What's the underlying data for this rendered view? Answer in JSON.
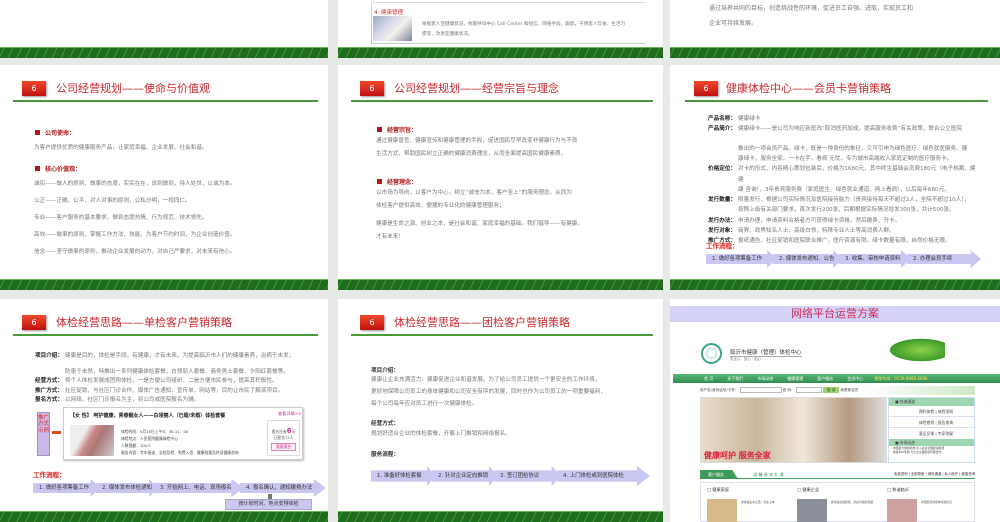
{
  "top_row": {
    "s2_heading": "4. 健康管理",
    "s2_text": [
      "根据客人亚健康状况，依靠呼叫中心 Call Center 和短信、网络手段，跟踪，干预客人饮食、生活习",
      "惯等，改善亚健康状况。"
    ],
    "s3_text": [
      "通过培养共同的目标，创造挑战性的环境，促进员工自强、进取，实现员工和",
      "企业可持续发展。"
    ]
  },
  "slide_number": "6",
  "mission": {
    "title": "公司经营规划——使命与价值观",
    "h1": "公司使命：",
    "p1": "为客户提供优质的健康服务产品，让家庭幸福、企业发展、社会和谐。",
    "h2": "核心价值观：",
    "values": [
      "诚实——做人的原则，做事的态度，实实在在，说到做到，待人处世，以诚为本。",
      "公正——正确、公平，对人对事的原则，公私分明，一视同仁。",
      "专业——客户服务的基本要求，做到态度热情、行为规范、技术领先。",
      "高效——做事的原则，掌握工作方法、技能，为客户节约时间，为企业创造价值。",
      "信念——坚守做事的原则，推动企业发展的动力，对自己严要求，对未来有信心。"
    ]
  },
  "purpose": {
    "title": "公司经营规划——经营宗旨与理念",
    "h1": "经营宗旨：",
    "p1": [
      "通过健康普查、健康宣传和健康管理的手段，促进国民尽早改变非健康行为与不良",
      "生活方式，帮助国民树立正确的健康消费理念，从而全面提高国民健康素质。"
    ],
    "h2": "经营理念：",
    "p2": [
      "以市场为导向，以客户为中心，树立“诚信为本，客户至上”的服务理念，从而为",
      "体检客户提供高效、便捷的专业化的健康管理服务；"
    ],
    "p3": [
      "健康是生命之源、创业之本，是社会和谐、家庭幸福的基础。我们倡导——有健康，",
      "才有未来！"
    ]
  },
  "card": {
    "title": "健康体检中心——会员卡营销策略",
    "lines": [
      {
        "k": "产品名称：",
        "v": "健康绿卡"
      },
      {
        "k": "产品简介：",
        "v": "健康绿卡——是公司为响应新医改“取消医药加成，提高服务收费”有关政策，联合公立医院"
      },
      {
        "k": "",
        "v": "推出的一项会员产品。绿卡，既是一种身份的象征，又可引申为绿色医疗、绿色就医服务、健"
      },
      {
        "k": "",
        "v": "康绿卡，服务全家。一卡在手，看病 无忧。专为城市高端收入家庭定制的医疗服务卡。"
      },
      {
        "k": "价格定位：",
        "v": "对卡的形式、内容精心策划包装后，价格为1680元，其中终生基础会员费180元（电子档案、健"
      },
      {
        "k": "",
        "v": "健"
      },
      {
        "k": "",
        "v": "康 咨询），3年贵宾服务费（家庭医生、绿色就业通道、网上看病），以后每年680元。"
      },
      {
        "k": "发行数量：",
        "v": "限量发行，根据公司实际情况及医院接待能力（贵宾接待每天不超过2人，全院不超过10人），"
      },
      {
        "k": "",
        "v": "按照上级有关部门要求，首次发行200张，后期根据实际情况增发300张，共计500张。"
      },
      {
        "k": "发行办法：",
        "v": "申请办理，申请资料合格者方可获得绿卡资格，然后缴费、开卡。"
      },
      {
        "k": "发行对象：",
        "v": "商界、政界知名人士，高级白领，特殊专业人士等高消费人群。"
      },
      {
        "k": "推广方式：",
        "v": "报纸通告、社区促销和医院联合推广，医疗资源有限，绿卡数量有限，自然价格无限。"
      }
    ],
    "flow_label": "工作流程：",
    "flow": [
      "1. 做好各项筹备工作",
      "2. 媒体发布通知、公告",
      "3. 收集、审核申请资料",
      "2. 办理会员手续"
    ]
  },
  "single": {
    "title": "体检经营思路——单检客户营销策略",
    "lines": [
      {
        "k": "项目介绍：",
        "v": "健康是目的，体检是手段。有健康，才有未来。为提高临沂市人们的健康素养，治病于未发，"
      },
      {
        "k": "",
        "v": "防患于未然，特推出一系列健康体检套餐，白领丽人套餐、商务男士套餐、夕阳红套餐等。"
      },
      {
        "k": "经营方式：",
        "v": "将个人体检发展成团购体检，一是方便公司组织，二是方便市民参与，提高其积极性。"
      },
      {
        "k": "推广方式：",
        "v": "社区促销，与社区门诊合作，媒体广告通知，宣传单，网站等，目的让市民了解该项目。"
      },
      {
        "k": "报名方式：",
        "v": "以网络、社区门诊报名为主，到公司或医院报名为辅。"
      }
    ],
    "example_label": "推广方式示例",
    "ad": {
      "headline": "【女 性】 呵护健康，青春靓女人——白领丽人（已婚/未婚）体检套餐",
      "more": "查看详情>>",
      "details": [
        "体检时间：5月10日上午8：30-11：00",
        "体检地点：人民医院健康体检中心",
        "人数限额：100人",
        "服务内容：专车接送、全程导检、免费入会、健康档案及终身健康咨询"
      ],
      "days_pre": "报名还有",
      "days": "6",
      "days_post": "天",
      "signed": "已报名72人",
      "signup": "我要报名"
    },
    "flow_label": "工作流程：",
    "flow": [
      "1. 做好各项筹备工作",
      "2. 媒体发布体检通知",
      "3. 开始网上、电话、现场报名",
      "4. 报名确认，通知缴费办法"
    ],
    "flow_sub": "按计划时间、地点安排体检"
  },
  "group": {
    "title": "体检经营思路——团检客户营销策略",
    "h1": "项目介绍：",
    "p1": [
      "健康让企业充满活力，健康促进企业和谐发展。为了给公司员工提供一个更安全的工作环境，",
      "更好地保障公司员工的身体健康和公司安全有序的发展，同时也作为公司员工的一项重要福利，",
      "每个公司每年应对员工进行一次健康体检。"
    ],
    "h2": "经营方式：",
    "p2": "规划好适合企业的体检套餐，开展上门推销和网络报名。",
    "h3": "服务流程：",
    "flow": [
      "1. 准备好体检套餐",
      "2. 针对企业定向推销",
      "3. 签订团检协议",
      "4. 上门体检或到医院体检"
    ]
  },
  "web": {
    "title": "网络平台运营方案",
    "site_name": "临沂市健康（管理）体检中心",
    "site_sub": "安全心 · 放心 · 贴心",
    "nav": [
      "首 页",
      "关于我们",
      "市场动态",
      "健康管理",
      "客户服务",
      "会员中心"
    ],
    "hotline": "客服专线：0539-8688 6688",
    "login_user": "用户名/身份证号/卡号：",
    "login_pwd": "密 码：",
    "login_btn": "登 录",
    "new_member": "我是新会员",
    "banner_slogan": "健康呵护 服务全家",
    "quick_title": "快速通道",
    "quick": [
      "预约体检 | 体检须知",
      "体检套餐 | 报告查询",
      "意见反馈 | 专家答疑"
    ],
    "news_title": "市场动态",
    "news": [
      "中国最大体检机构 引入商业全面健康检测",
      "健康365专题 与企业全面健康管理合作"
    ],
    "service_title": "客户服务",
    "service_slogan": "温 馨 贵 宾 礼 遇",
    "service_links": "免费咨询 | 全部导医 | 绿色通道 | 私人医疗 | 健康咨询",
    "columns": [
      "健康家庭",
      "健康企业",
      "和谐临沂"
    ],
    "col_text": [
      "健康是生命之源，创业之本",
      "健康是社会和谐，家庭幸福的基础",
      "中国民营健康体检最前沿"
    ]
  },
  "colors": {
    "title_red": "#c8282e",
    "green": "#4a9a3a",
    "arrow": "#c8c8f2"
  }
}
